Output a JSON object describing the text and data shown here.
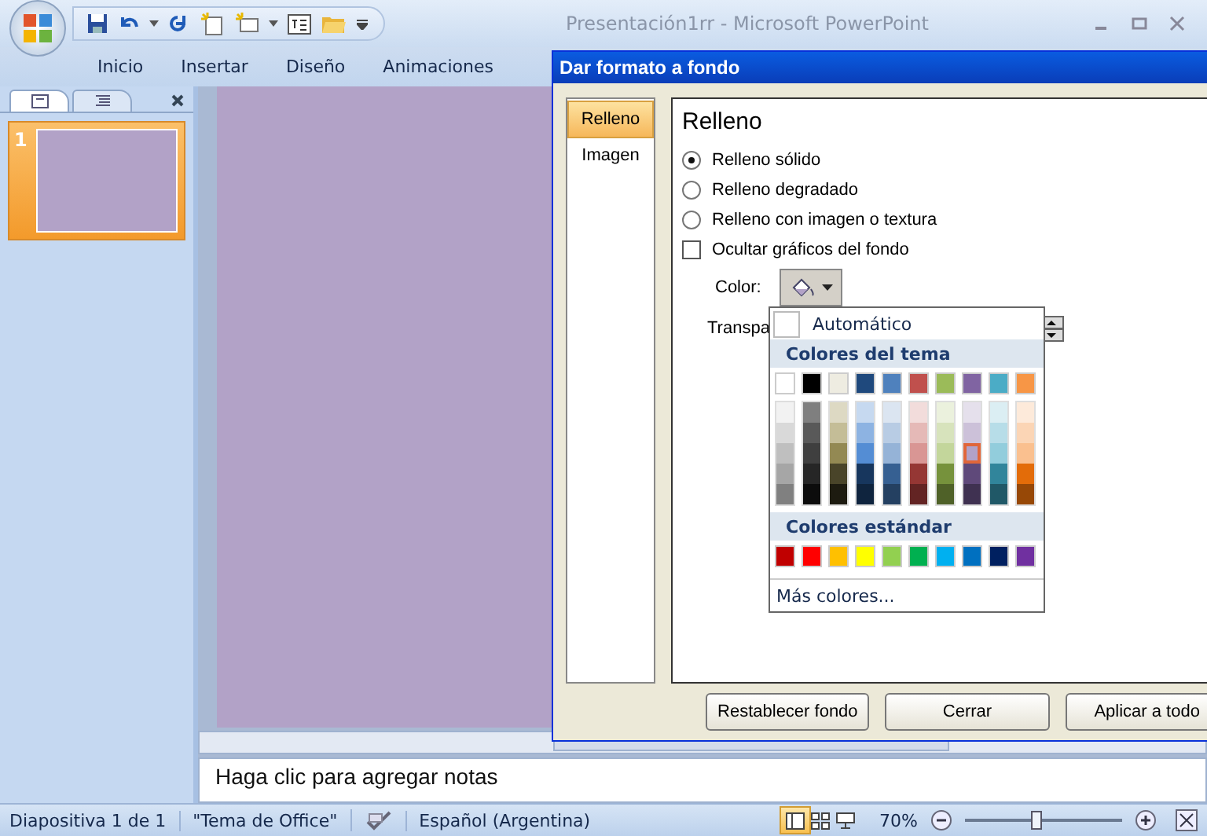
{
  "window": {
    "title": "Presentación1rr - Microsoft PowerPoint"
  },
  "ribbon_tabs": [
    "Inicio",
    "Insertar",
    "Diseño",
    "Animaciones"
  ],
  "slides_panel": {
    "tabs": [
      {
        "kind": "slides",
        "selected": true
      },
      {
        "kind": "outline",
        "selected": false
      }
    ],
    "thumbnails": [
      {
        "number": "1",
        "selected": true
      }
    ]
  },
  "notes": {
    "placeholder": "Haga clic para agregar notas"
  },
  "dialog": {
    "title": "Dar formato a fondo",
    "nav": [
      {
        "label": "Relleno",
        "selected": true
      },
      {
        "label": "Imagen",
        "selected": false
      }
    ],
    "heading": "Relleno",
    "options": [
      {
        "kind": "radio",
        "label": "Relleno sólido",
        "checked": true
      },
      {
        "kind": "radio",
        "label": "Relleno degradado",
        "checked": false
      },
      {
        "kind": "radio",
        "label": "Relleno con imagen o textura",
        "checked": false
      },
      {
        "kind": "checkbox",
        "label": "Ocultar gráficos del fondo",
        "checked": false
      }
    ],
    "color_label": "Color:",
    "transparency_label": "Transpa",
    "buttons": [
      "Restablecer fondo",
      "Cerrar",
      "Aplicar a todo"
    ]
  },
  "color_menu": {
    "automatic": "Automático",
    "theme_header": "Colores del tema",
    "theme_base": [
      {
        "color": "#ffffff",
        "selected": false
      },
      {
        "color": "#000000",
        "selected": false
      },
      {
        "color": "#eeece1",
        "selected": false
      },
      {
        "color": "#1f497d",
        "selected": false
      },
      {
        "color": "#4f81bd",
        "selected": false
      },
      {
        "color": "#c0504d",
        "selected": false
      },
      {
        "color": "#9bbb59",
        "selected": false
      },
      {
        "color": "#8064a2",
        "selected": false
      },
      {
        "color": "#4bacc6",
        "selected": false
      },
      {
        "color": "#f79646",
        "selected": false
      }
    ],
    "theme_shades": [
      [
        {
          "color": "#f2f2f2",
          "selected": false
        },
        {
          "color": "#d9d9d9",
          "selected": false
        },
        {
          "color": "#bfbfbf",
          "selected": false
        },
        {
          "color": "#a6a6a6",
          "selected": false
        },
        {
          "color": "#808080",
          "selected": false
        }
      ],
      [
        {
          "color": "#7f7f7f",
          "selected": false
        },
        {
          "color": "#595959",
          "selected": false
        },
        {
          "color": "#3f3f3f",
          "selected": false
        },
        {
          "color": "#262626",
          "selected": false
        },
        {
          "color": "#0c0c0c",
          "selected": false
        }
      ],
      [
        {
          "color": "#ddd9c3",
          "selected": false
        },
        {
          "color": "#c4bd97",
          "selected": false
        },
        {
          "color": "#938953",
          "selected": false
        },
        {
          "color": "#494429",
          "selected": false
        },
        {
          "color": "#1d1b10",
          "selected": false
        }
      ],
      [
        {
          "color": "#c6d9f0",
          "selected": false
        },
        {
          "color": "#8db3e2",
          "selected": false
        },
        {
          "color": "#548dd4",
          "selected": false
        },
        {
          "color": "#17365d",
          "selected": false
        },
        {
          "color": "#0f243e",
          "selected": false
        }
      ],
      [
        {
          "color": "#dbe5f1",
          "selected": false
        },
        {
          "color": "#b8cce4",
          "selected": false
        },
        {
          "color": "#95b3d7",
          "selected": false
        },
        {
          "color": "#366092",
          "selected": false
        },
        {
          "color": "#244061",
          "selected": false
        }
      ],
      [
        {
          "color": "#f2dcdb",
          "selected": false
        },
        {
          "color": "#e5b9b7",
          "selected": false
        },
        {
          "color": "#d99694",
          "selected": false
        },
        {
          "color": "#953734",
          "selected": false
        },
        {
          "color": "#632423",
          "selected": false
        }
      ],
      [
        {
          "color": "#ebf1dd",
          "selected": false
        },
        {
          "color": "#d7e3bc",
          "selected": false
        },
        {
          "color": "#c3d69b",
          "selected": false
        },
        {
          "color": "#76923c",
          "selected": false
        },
        {
          "color": "#4f6128",
          "selected": false
        }
      ],
      [
        {
          "color": "#e5e0ec",
          "selected": false
        },
        {
          "color": "#ccc1d9",
          "selected": false
        },
        {
          "color": "#b2a2c7",
          "selected": true
        },
        {
          "color": "#5f497a",
          "selected": false
        },
        {
          "color": "#3f3151",
          "selected": false
        }
      ],
      [
        {
          "color": "#dbeef3",
          "selected": false
        },
        {
          "color": "#b7dde8",
          "selected": false
        },
        {
          "color": "#92cddc",
          "selected": false
        },
        {
          "color": "#31859b",
          "selected": false
        },
        {
          "color": "#205867",
          "selected": false
        }
      ],
      [
        {
          "color": "#fdeada",
          "selected": false
        },
        {
          "color": "#fbd5b5",
          "selected": false
        },
        {
          "color": "#fac08f",
          "selected": false
        },
        {
          "color": "#e36c09",
          "selected": false
        },
        {
          "color": "#974806",
          "selected": false
        }
      ]
    ],
    "standard_header": "Colores estándar",
    "standard": [
      {
        "color": "#c00000",
        "selected": false
      },
      {
        "color": "#ff0000",
        "selected": false
      },
      {
        "color": "#ffc000",
        "selected": false
      },
      {
        "color": "#ffff00",
        "selected": false
      },
      {
        "color": "#92d050",
        "selected": false
      },
      {
        "color": "#00b050",
        "selected": false
      },
      {
        "color": "#00b0f0",
        "selected": false
      },
      {
        "color": "#0070c0",
        "selected": false
      },
      {
        "color": "#002060",
        "selected": false
      },
      {
        "color": "#7030a0",
        "selected": false
      }
    ],
    "more": "Más colores..."
  },
  "status_bar": {
    "slide": "Diapositiva 1 de 1",
    "theme": "\"Tema de Office\"",
    "language": "Español (Argentina)",
    "views": [
      {
        "kind": "normal",
        "selected": true
      },
      {
        "kind": "sorter",
        "selected": false
      },
      {
        "kind": "show",
        "selected": false
      }
    ],
    "zoom": "70%",
    "zoom_slider": {
      "level": 0.45
    }
  }
}
